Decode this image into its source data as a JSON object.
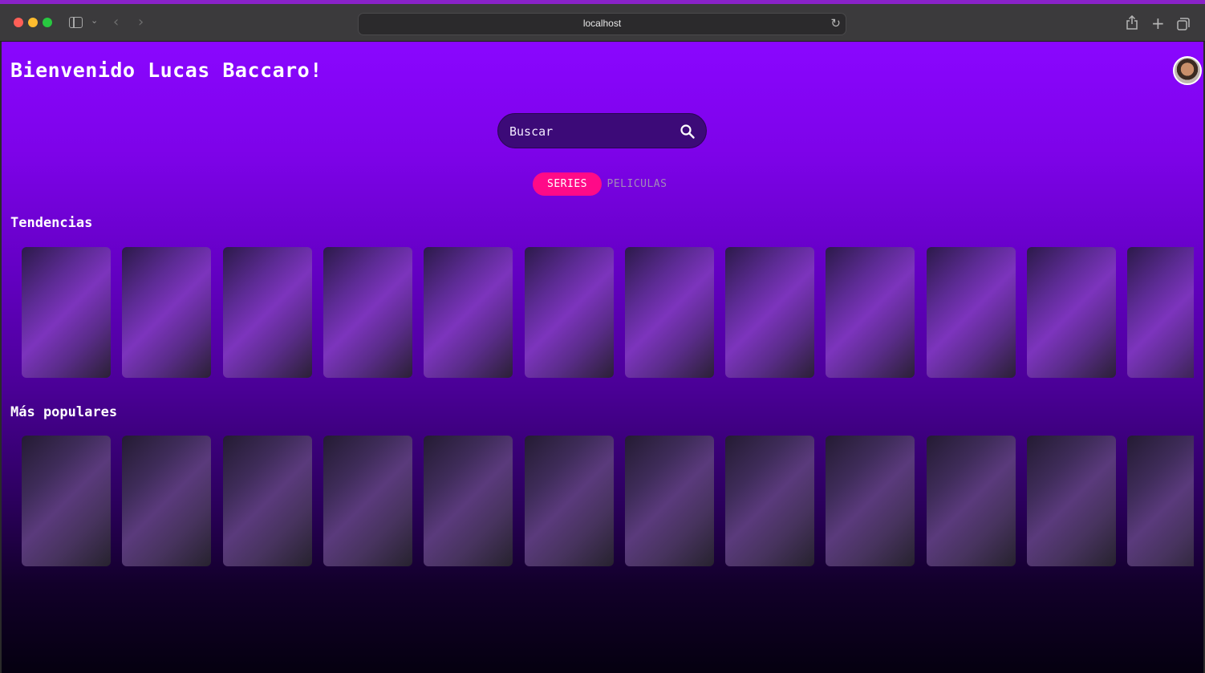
{
  "browser": {
    "url": "localhost"
  },
  "header": {
    "welcome": "Bienvenido Lucas Baccaro!"
  },
  "search": {
    "placeholder": "Buscar"
  },
  "tabs": [
    {
      "label": "SERIES",
      "active": true
    },
    {
      "label": "PELICULAS",
      "active": false
    }
  ],
  "sections": {
    "trending": {
      "title": "Tendencias",
      "card_count": 12
    },
    "popular": {
      "title": "Más populares",
      "card_count": 12
    }
  },
  "colors": {
    "accent": "#ff0a88",
    "gradient_top": "#8a06ff",
    "gradient_bottom": "#050010"
  }
}
